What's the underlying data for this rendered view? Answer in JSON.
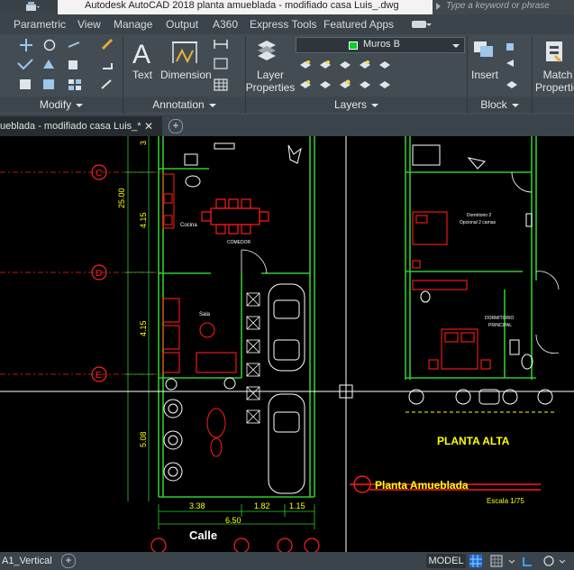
{
  "app": {
    "title": "Autodesk AutoCAD 2018      planta amueblada - modifiado casa Luis_.dwg",
    "search_placeholder": "Type a keyword or phrase"
  },
  "ribbon_tabs": [
    "Parametric",
    "View",
    "Manage",
    "Output",
    "A360",
    "Express Tools",
    "Featured Apps"
  ],
  "ribbon": {
    "modify_panel": "Modify",
    "annotation_panel": "Annotation",
    "layers_panel": "Layers",
    "block_panel": "Block",
    "text_button": "Text",
    "dimension_button": "Dimension",
    "layer_properties_line1": "Layer",
    "layer_properties_line2": "Properties",
    "insert_button": "Insert",
    "match_properties_line1": "Match",
    "match_properties_line2": "Propertie",
    "current_layer": "Muros B",
    "current_layer_color": "#00d12d"
  },
  "document_tab": {
    "label": "ueblada - modifiado casa Luis_*",
    "close": "✕"
  },
  "drawing": {
    "grid_labels": [
      "C",
      "D",
      "E"
    ],
    "dim_vertical_total": "25.00",
    "dim_vertical_1": "4.15",
    "dim_vertical_2": "4.15",
    "dim_vertical_3": "5.08",
    "dim_vertical_top": "3",
    "dim_bottom_1": "3.38",
    "dim_bottom_2": "1.82",
    "dim_bottom_3": "1.15",
    "dim_bottom_total": "6.50",
    "street_label": "Calle",
    "room_kitchen": "Cocina",
    "room_dining": "COMEDOR",
    "room_living": "Sala",
    "room_bedroom2_line1": "Dormitorio 2",
    "room_bedroom2_line2": "Opcional 2 camas",
    "room_master_line1": "DORMITORIO",
    "room_master_line2": "PRINCIPAL",
    "upper_floor_title": "PLANTA ALTA",
    "furnished_plan_title": "Planta Amueblada",
    "scale_label": "Escala 1/75",
    "colors": {
      "walls": "#2ecc2e",
      "furniture": "#ff1a1a",
      "fixtures": "#ffffff",
      "dimensions": "#ffff00",
      "gridlines": "#ff2020"
    }
  },
  "status": {
    "layout_tab": "A1_Vertical",
    "model_button": "MODEL"
  }
}
